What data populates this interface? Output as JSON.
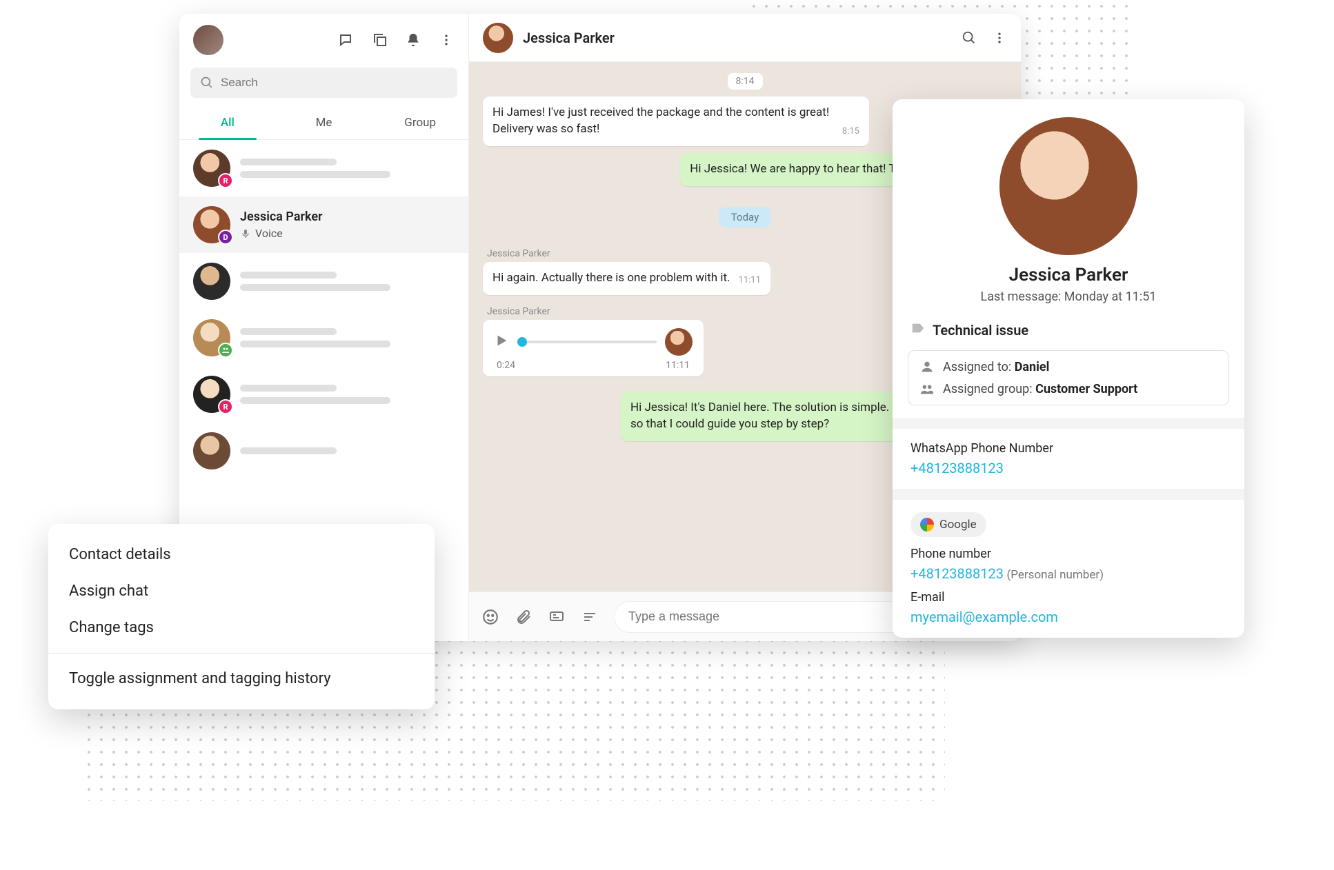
{
  "sidebar": {
    "search_placeholder": "Search",
    "tabs": {
      "all": "All",
      "me": "Me",
      "group": "Group"
    },
    "active_tab": "All",
    "chats": [
      {
        "badge": "R",
        "badge_class": "badge-pink"
      },
      {
        "name": "Jessica Parker",
        "sub": "Voice",
        "badge": "D",
        "badge_class": "badge-purple",
        "selected": true
      },
      {
        "badge": "",
        "badge_class": ""
      },
      {
        "badge": "",
        "badge_class": "badge-green"
      },
      {
        "badge": "R",
        "badge_class": "badge-pink"
      },
      {
        "badge": "",
        "badge_class": ""
      }
    ]
  },
  "conversation": {
    "header_name": "Jessica Parker",
    "first_time": "8:14",
    "msg1": {
      "text": "Hi James! I've just received the package and the content is great! Delivery was so fast!",
      "ts": "8:15"
    },
    "reply1": {
      "text": "Hi Jessica! We are happy to hear that! Thanks for the order!",
      "ts": ""
    },
    "date_chip": "Today",
    "sender_label": "Jessica Parker",
    "msg2": {
      "text": "Hi again. Actually there is one problem with it.",
      "ts": "11:11"
    },
    "voice": {
      "duration": "0:24",
      "ts": "11:11"
    },
    "reply2": {
      "text": "Hi Jessica! It's Daniel here. The solution is simple. Shall we have a call so that I could guide you step by step?",
      "ts": ""
    },
    "input_placeholder": "Type a message"
  },
  "context_menu": {
    "items": [
      "Contact details",
      "Assign chat",
      "Change tags"
    ],
    "toggle": "Toggle assignment and tagging history"
  },
  "contact": {
    "name": "Jessica Parker",
    "last_message": "Last message: Monday at 11:51",
    "tag": "Technical issue",
    "assigned_to_label": "Assigned to:",
    "assigned_to": "Daniel",
    "assigned_group_label": "Assigned group:",
    "assigned_group": "Customer Support",
    "whatsapp_label": "WhatsApp Phone Number",
    "whatsapp_phone": "+48123888123",
    "source": "Google",
    "phone_label": "Phone number",
    "phone": "+48123888123",
    "phone_note": "(Personal number)",
    "email_label": "E-mail",
    "email": "myemail@example.com"
  }
}
